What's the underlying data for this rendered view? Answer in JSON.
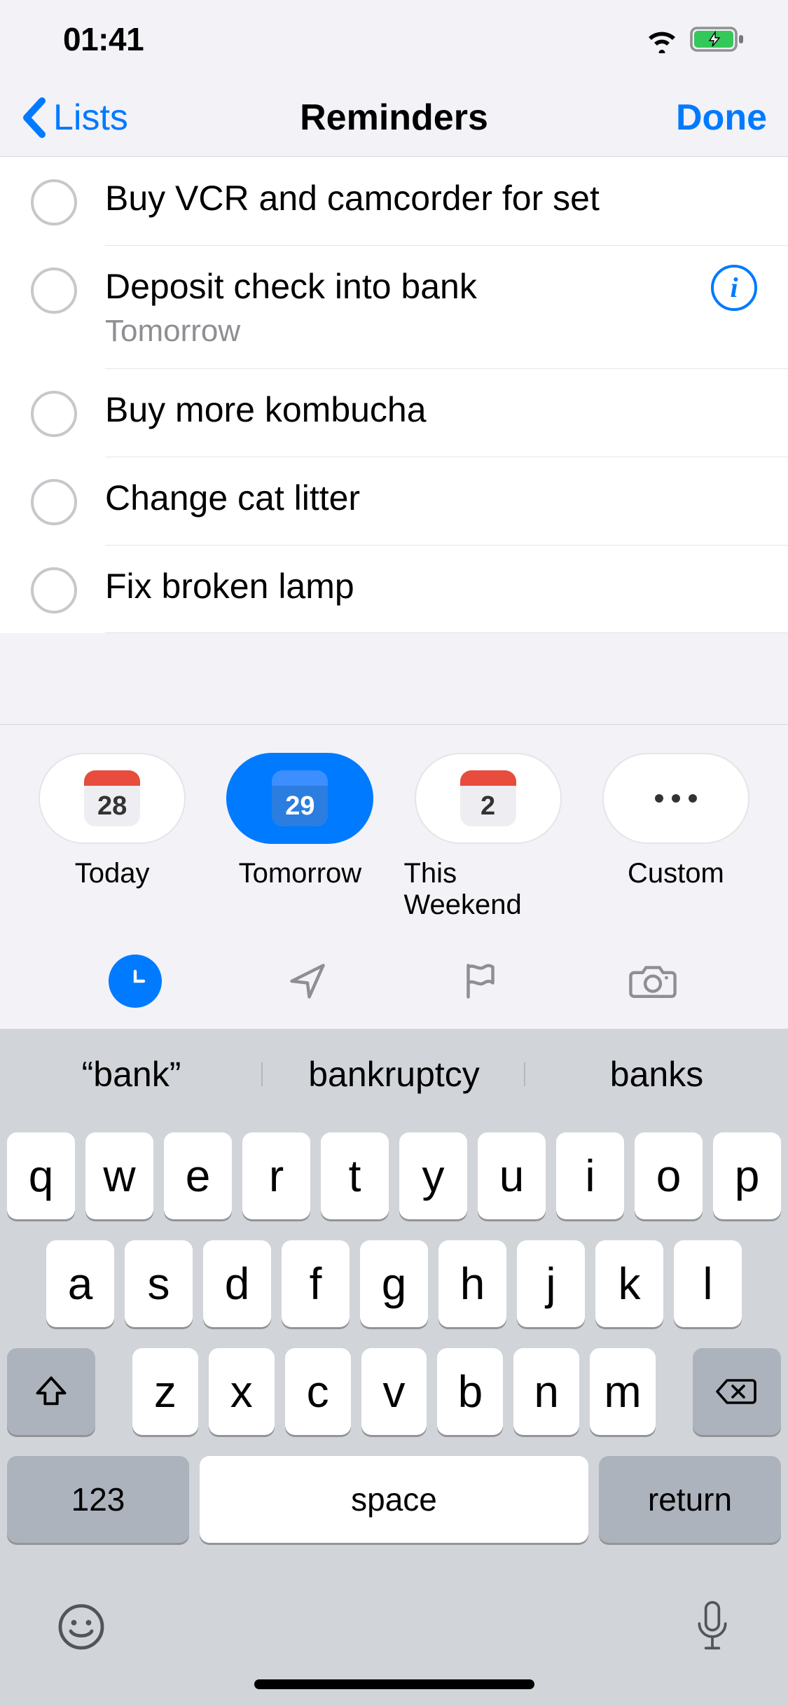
{
  "status": {
    "time": "01:41"
  },
  "nav": {
    "back_label": "Lists",
    "title": "Reminders",
    "done_label": "Done"
  },
  "reminders": [
    {
      "title": "Buy VCR and camcorder for set",
      "subtitle": null,
      "info": false
    },
    {
      "title": "Deposit check into bank",
      "subtitle": "Tomorrow",
      "info": true
    },
    {
      "title": "Buy more kombucha",
      "subtitle": null,
      "info": false
    },
    {
      "title": "Change cat litter",
      "subtitle": null,
      "info": false
    },
    {
      "title": "Fix broken lamp",
      "subtitle": null,
      "info": false
    }
  ],
  "date_chips": {
    "today": {
      "num": "28",
      "label": "Today"
    },
    "tomorrow": {
      "num": "29",
      "label": "Tomorrow"
    },
    "weekend": {
      "num": "2",
      "label": "This Weekend"
    },
    "custom": {
      "label": "Custom"
    }
  },
  "suggestions": [
    "“bank”",
    "bankruptcy",
    "banks"
  ],
  "keyboard": {
    "row1": [
      "q",
      "w",
      "e",
      "r",
      "t",
      "y",
      "u",
      "i",
      "o",
      "p"
    ],
    "row2": [
      "a",
      "s",
      "d",
      "f",
      "g",
      "h",
      "j",
      "k",
      "l"
    ],
    "row3": [
      "z",
      "x",
      "c",
      "v",
      "b",
      "n",
      "m"
    ],
    "num_label": "123",
    "space_label": "space",
    "return_label": "return"
  }
}
